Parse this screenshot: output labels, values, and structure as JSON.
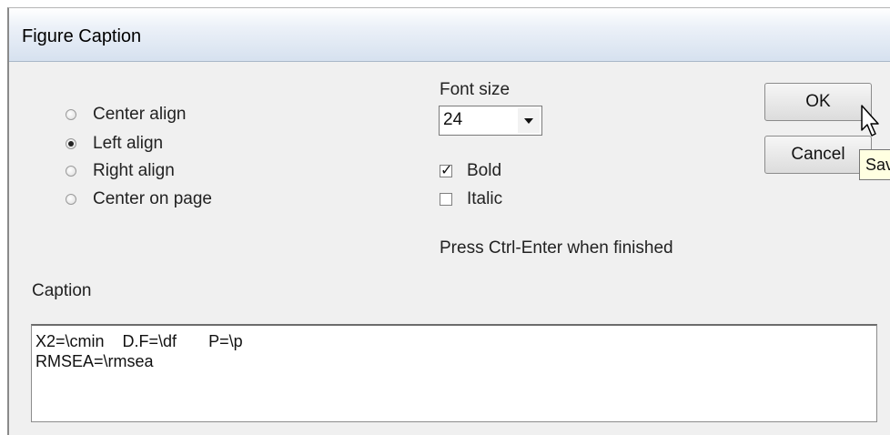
{
  "window": {
    "title": "Figure Caption"
  },
  "alignment": {
    "options": [
      {
        "label": "Center align",
        "checked": false
      },
      {
        "label": "Left align",
        "checked": true
      },
      {
        "label": "Right align",
        "checked": false
      },
      {
        "label": "Center on page",
        "checked": false
      }
    ]
  },
  "font_size": {
    "label": "Font size",
    "selected": "24"
  },
  "style": {
    "bold": {
      "label": "Bold",
      "checked": true
    },
    "italic": {
      "label": "Italic",
      "checked": false
    }
  },
  "hint": "Press Ctrl-Enter when finished",
  "buttons": {
    "ok": "OK",
    "cancel": "Cancel"
  },
  "tooltip": "Sav",
  "caption": {
    "label": "Caption",
    "lines": [
      "X2=\\cmin    D.F=\\df       P=\\p",
      "RMSEA=\\rmsea"
    ]
  }
}
